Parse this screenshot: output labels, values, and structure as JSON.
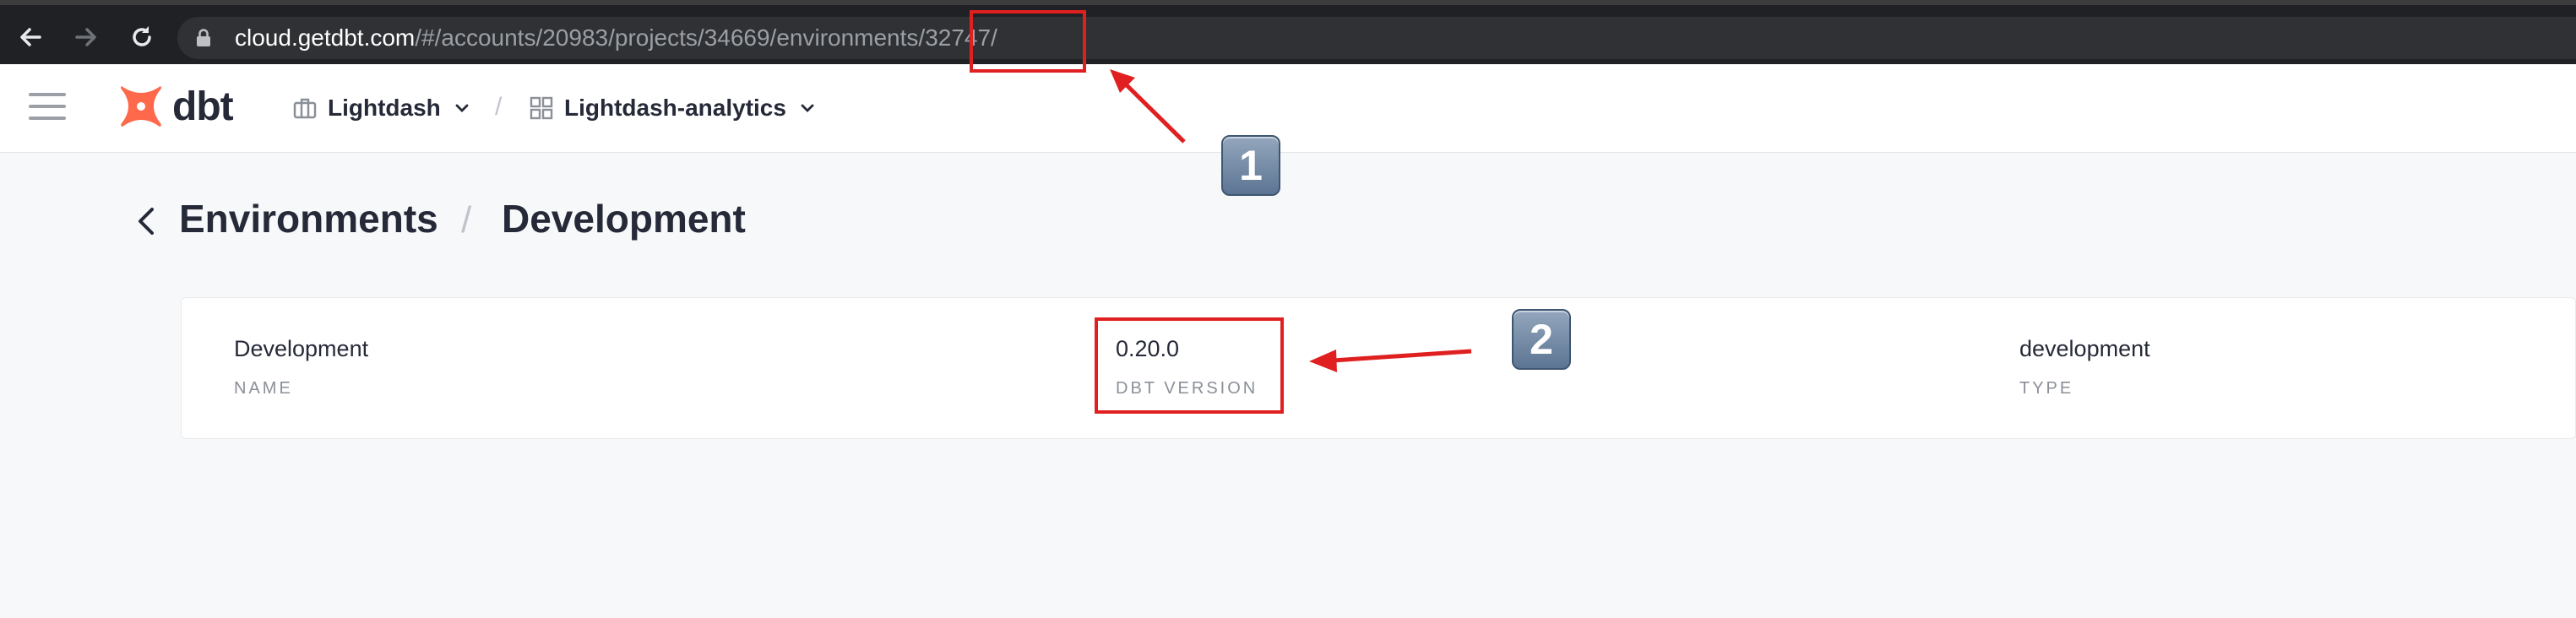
{
  "browser": {
    "url_host": "cloud.getdbt.com",
    "url_path": "/#/accounts/20983/projects/34669/environments/32747/",
    "back_icon": "arrow-left-icon",
    "forward_icon": "arrow-right-icon",
    "reload_icon": "reload-icon",
    "lock_icon": "lock-icon"
  },
  "header": {
    "logo_text": "dbt",
    "account_label": "Lightdash",
    "project_label": "Lightdash-analytics",
    "separator": "/"
  },
  "page": {
    "breadcrumb_parent": "Environments",
    "separator": "/",
    "title": "Development"
  },
  "environment": {
    "name_value": "Development",
    "name_label": "NAME",
    "version_value": "0.20.0",
    "version_label": "DBT VERSION",
    "type_value": "development",
    "type_label": "TYPE"
  },
  "annotations": {
    "badge_1": "1",
    "badge_2": "2",
    "highlight_color": "#e02020"
  },
  "colors": {
    "brand_orange": "#ff694b",
    "text_dark": "#262a38",
    "label_gray": "#8a8f98"
  }
}
